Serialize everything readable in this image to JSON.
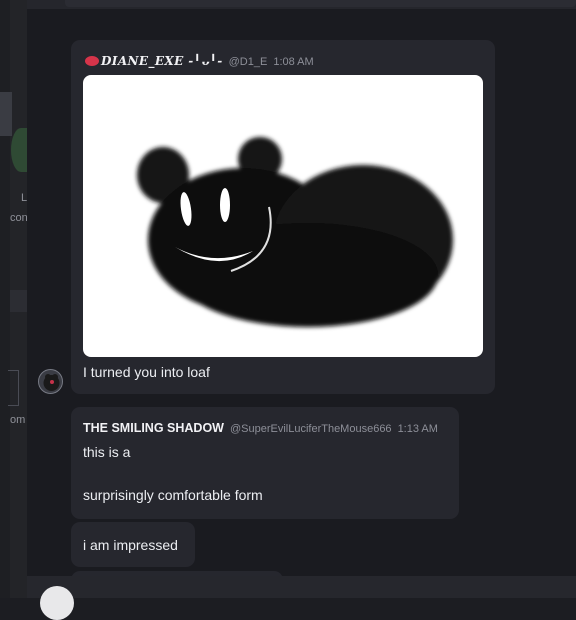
{
  "left_panel": {
    "snippet_1": "L",
    "snippet_2": "con",
    "snippet_3": "om"
  },
  "messages": [
    {
      "author": "DIANE_EXE -╹ᴗ╹-",
      "handle": "@D1_E",
      "time": "1:08 AM",
      "text": "I turned you into loaf"
    },
    {
      "author": "THE SMILING SHADOW",
      "handle": "@SuperEvilLuciferTheMouse666",
      "time": "1:13 AM",
      "line_1": "this is a",
      "line_2": "surprisingly comfortable form"
    },
    {
      "text": "i am impressed"
    }
  ],
  "colors": {
    "background": "#1a1b20",
    "bubble": "#26272e",
    "badge": "#d6344a"
  },
  "icons": {
    "badge": "heart-badge-icon",
    "attachment": "loaf-mouse-drawing"
  }
}
